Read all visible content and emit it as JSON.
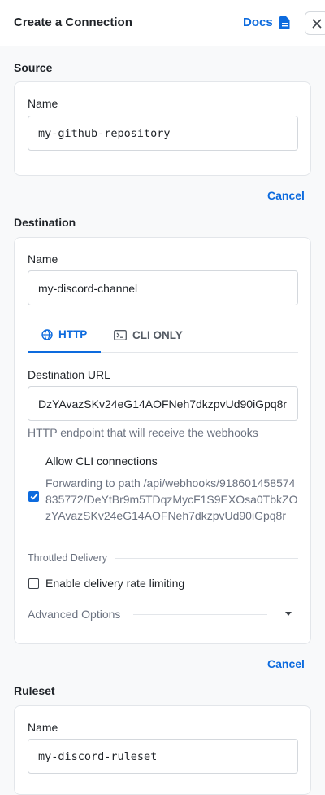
{
  "header": {
    "title": "Create a Connection",
    "docs_label": "Docs"
  },
  "source": {
    "section_title": "Source",
    "name_label": "Name",
    "name_value": "my-github-repository",
    "cancel_label": "Cancel"
  },
  "destination": {
    "section_title": "Destination",
    "name_label": "Name",
    "name_value": "my-discord-channel",
    "tabs": [
      {
        "label": "HTTP",
        "icon": "globe-icon",
        "active": true
      },
      {
        "label": "CLI ONLY",
        "icon": "terminal-icon",
        "active": false
      }
    ],
    "url_label": "Destination URL",
    "url_value": "DzYAvazSKv24eG14AOFNeh7dkzpvUd90iGpq8r",
    "url_help": "HTTP endpoint that will receive the webhooks",
    "allow_cli_label": "Allow CLI connections",
    "allow_cli_checked": true,
    "forwarding_note": "Forwarding to path /api/webhooks/918601458574835772/DeYtBr9m5TDqzMycF1S9EXOsa0TbkZOzYAvazSKv24eG14AOFNeh7dkzpvUd90iGpq8r",
    "throttled_label": "Throttled Delivery",
    "rate_limit_label": "Enable delivery rate limiting",
    "rate_limit_checked": false,
    "advanced_label": "Advanced Options",
    "cancel_label": "Cancel"
  },
  "ruleset": {
    "section_title": "Ruleset",
    "name_label": "Name",
    "name_value": "my-discord-ruleset"
  },
  "colors": {
    "accent": "#0d6bde",
    "border": "#e3e6ea",
    "muted": "#6b7280"
  }
}
